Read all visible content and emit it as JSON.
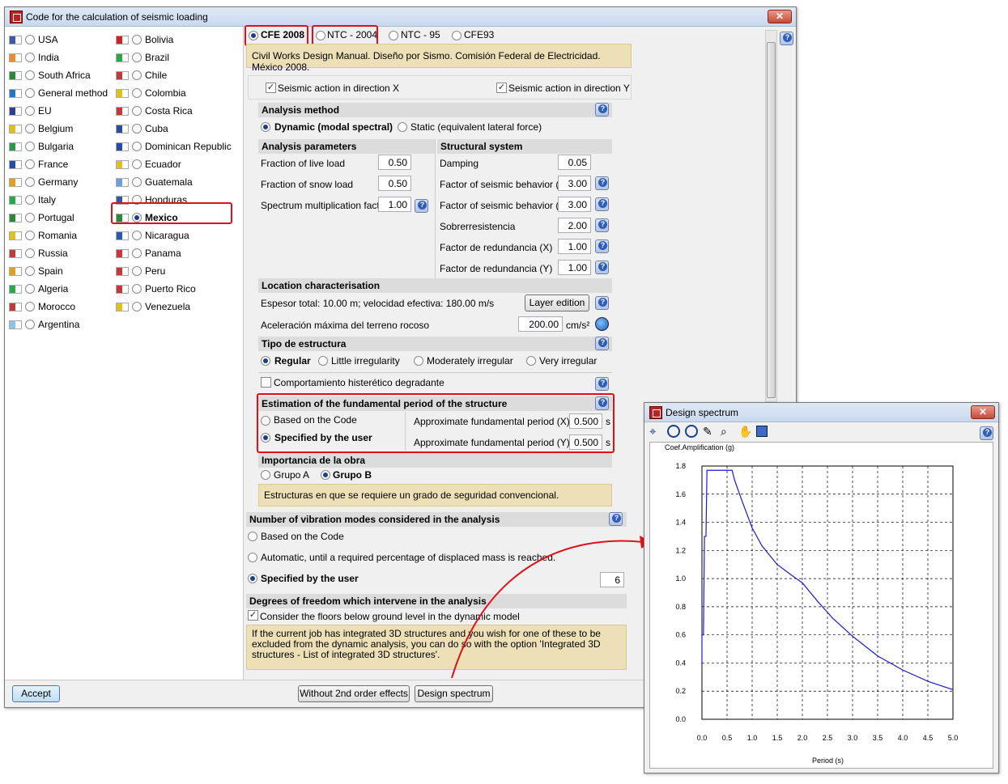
{
  "main_window": {
    "title": "Code for the calculation of seismic loading",
    "close": "✕"
  },
  "countries_col1": [
    "USA",
    "India",
    "South Africa",
    "General method",
    "EU",
    "Belgium",
    "Bulgaria",
    "France",
    "Germany",
    "Italy",
    "Portugal",
    "Romania",
    "Russia",
    "Spain",
    "Algeria",
    "Morocco",
    "Argentina"
  ],
  "countries_col2": [
    "Bolivia",
    "Brazil",
    "Chile",
    "Colombia",
    "Costa Rica",
    "Cuba",
    "Dominican Republic",
    "Ecuador",
    "Guatemala",
    "Honduras",
    "Mexico",
    "Nicaragua",
    "Panama",
    "Peru",
    "Puerto Rico",
    "Venezuela"
  ],
  "code_tabs": [
    "CFE 2008",
    "NTC - 2004",
    "NTC - 95",
    "CFE93"
  ],
  "code_description": "Civil Works Design Manual. Diseño por Sismo. Comisión Federal de Electricidad. México 2008.",
  "seismic_x": "Seismic action in direction X",
  "seismic_y": "Seismic action in direction Y",
  "analysis_method": {
    "title": "Analysis method",
    "dynamic": "Dynamic (modal spectral)",
    "static": "Static (equivalent lateral force)"
  },
  "analysis_parameters": {
    "title": "Analysis parameters",
    "rows": [
      {
        "label": "Fraction of live load",
        "value": "0.50"
      },
      {
        "label": "Fraction of snow load",
        "value": "0.50"
      },
      {
        "label": "Spectrum multiplication factor",
        "value": "1.00"
      }
    ]
  },
  "structural_system": {
    "title": "Structural system",
    "rows": [
      {
        "label": "Damping",
        "value": "0.05"
      },
      {
        "label": "Factor of seismic behavior (X)",
        "value": "3.00"
      },
      {
        "label": "Factor of seismic behavior (Y)",
        "value": "3.00"
      },
      {
        "label": "Sobrerresistencia",
        "value": "2.00"
      },
      {
        "label": "Factor de redundancia (X)",
        "value": "1.00"
      },
      {
        "label": "Factor de redundancia (Y)",
        "value": "1.00"
      }
    ]
  },
  "location": {
    "title": "Location characterisation",
    "text": "Espesor total: 10.00 m; velocidad efectiva: 180.00 m/s",
    "layer_button": "Layer edition",
    "accel_label": "Aceleración máxima del terreno rocoso",
    "accel_value": "200.00",
    "accel_unit": "cm/s²"
  },
  "structure_type": {
    "title": "Tipo de estructura",
    "options": [
      "Regular",
      "Little irregularity",
      "Moderately irregular",
      "Very irregular"
    ]
  },
  "hysteretic": "Comportamiento histerético degradante",
  "fundamental_period": {
    "title": "Estimation of the fundamental period of the structure",
    "opt_code": "Based on the Code",
    "opt_user": "Specified by the user",
    "px_label": "Approximate fundamental period (X)",
    "px_value": "0.500",
    "py_label": "Approximate fundamental period (Y)",
    "py_value": "0.500",
    "unit": "s"
  },
  "importance": {
    "title": "Importancia de la obra",
    "a": "Grupo A",
    "b": "Grupo B",
    "info": "Estructuras en que se requiere un grado de seguridad convencional."
  },
  "vibration_modes": {
    "title": "Number of vibration modes considered in the analysis",
    "opt1": "Based on the Code",
    "opt2": "Automatic, until a required percentage of displaced mass is reached.",
    "opt3": "Specified by the user",
    "value": "6"
  },
  "dof": {
    "title": "Degrees of freedom which intervene in the analysis",
    "check": "Consider the floors below ground level in the dynamic model",
    "info": "If the current job has integrated 3D structures and you wish for one of these to be excluded from the dynamic analysis, you can do so with the option 'Integrated 3D structures - List of integrated 3D structures'."
  },
  "buttons": {
    "accept": "Accept",
    "without_2nd": "Without 2nd order effects",
    "design_spectrum": "Design spectrum"
  },
  "spectrum_window": {
    "title": "Design spectrum",
    "close": "✕"
  },
  "chart_data": {
    "type": "line",
    "title": "",
    "ylabel": "Coef.Amplification (g)",
    "xlabel": "Period (s)",
    "xlim": [
      0,
      5.0
    ],
    "ylim": [
      0,
      1.8
    ],
    "grid": true,
    "xticks": [
      "0.0",
      "0.5",
      "1.0",
      "1.5",
      "2.0",
      "2.5",
      "3.0",
      "3.5",
      "4.0",
      "4.5",
      "5.0"
    ],
    "yticks": [
      "0.0",
      "0.2",
      "0.4",
      "0.6",
      "0.8",
      "1.0",
      "1.2",
      "1.4",
      "1.6",
      "1.8"
    ],
    "series": [
      {
        "color": "#1a1ad0",
        "x": [
          0.0,
          0.0,
          0.03,
          0.05,
          0.08,
          0.1,
          0.15,
          0.6,
          0.65,
          0.8,
          1.0,
          1.2,
          1.5,
          1.8,
          2.0,
          2.3,
          2.6,
          3.0,
          3.5,
          4.0,
          4.5,
          5.0
        ],
        "y": [
          0.4,
          0.6,
          0.6,
          1.3,
          1.3,
          1.77,
          1.77,
          1.77,
          1.7,
          1.55,
          1.36,
          1.23,
          1.1,
          1.02,
          0.97,
          0.84,
          0.72,
          0.59,
          0.45,
          0.35,
          0.27,
          0.21
        ]
      }
    ]
  }
}
